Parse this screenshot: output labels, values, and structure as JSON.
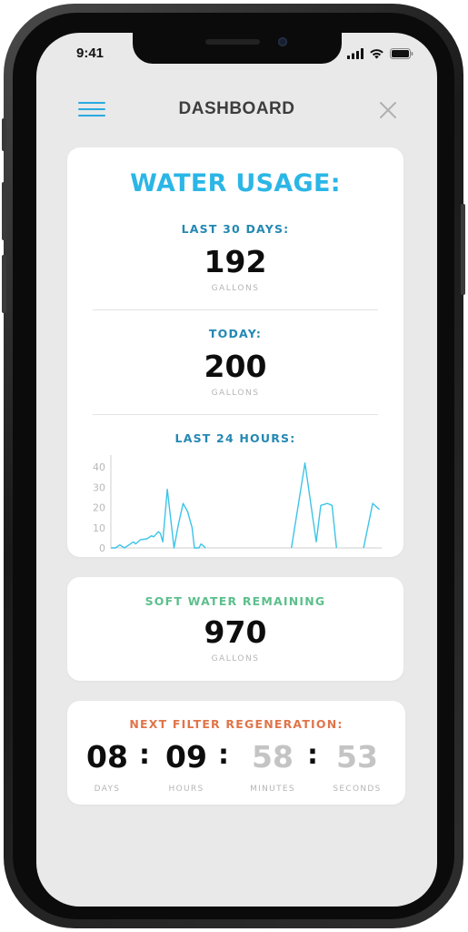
{
  "status_bar": {
    "time": "9:41",
    "icons": [
      "cellular-signal-icon",
      "wifi-icon",
      "battery-icon"
    ]
  },
  "header": {
    "title": "DASHBOARD",
    "menu_icon": "hamburger-menu-icon",
    "close_icon": "close-icon"
  },
  "colors": {
    "accent": "#2bb6e6",
    "label_blue": "#2488b3",
    "label_green": "#5cbf8c",
    "label_orange": "#e0744a",
    "chart_line": "#3cc4e8",
    "screen_bg": "#e9e9e9",
    "card_bg": "#ffffff"
  },
  "water_usage": {
    "title": "WATER USAGE:",
    "last_30_days": {
      "label": "LAST 30 DAYS:",
      "value": "192",
      "unit": "GALLONS"
    },
    "today": {
      "label": "TODAY:",
      "value": "200",
      "unit": "GALLONS"
    },
    "last_24_hours": {
      "label": "LAST 24 HOURS:"
    }
  },
  "soft_water": {
    "label": "SOFT WATER REMAINING",
    "value": "970",
    "unit": "GALLONS"
  },
  "regeneration": {
    "label": "NEXT FILTER REGENERATION:",
    "days": {
      "value": "08",
      "unit": "DAYS"
    },
    "hours": {
      "value": "09",
      "unit": "HOURS"
    },
    "minutes": {
      "value": "58",
      "unit": "MINUTES"
    },
    "seconds": {
      "value": "53",
      "unit": "SECONDS"
    },
    "separator": ":"
  },
  "chart_data": {
    "type": "line",
    "title": "",
    "xlabel": "",
    "ylabel": "",
    "ylim": [
      0,
      45
    ],
    "yticks": [
      "0",
      "10",
      "20",
      "30",
      "40"
    ],
    "grid": false,
    "series": [
      {
        "segments": [
          [
            [
              0,
              0
            ],
            [
              2,
              0
            ],
            [
              4,
              1.5
            ],
            [
              6,
              0
            ],
            [
              8,
              1.5
            ],
            [
              10,
              3
            ],
            [
              11,
              2
            ],
            [
              13,
              4
            ],
            [
              16,
              4.5
            ],
            [
              18,
              6
            ],
            [
              19,
              5.5
            ],
            [
              21,
              8
            ],
            [
              22,
              7
            ],
            [
              23,
              3
            ],
            [
              25,
              29
            ],
            [
              28,
              0
            ],
            [
              30,
              12
            ],
            [
              32,
              22
            ],
            [
              34,
              18
            ],
            [
              36,
              10
            ],
            [
              37,
              0
            ],
            [
              39,
              0
            ],
            [
              40,
              2
            ],
            [
              42,
              0
            ]
          ],
          [
            [
              80,
              0
            ],
            [
              86,
              42
            ],
            [
              91,
              3
            ],
            [
              93,
              21
            ],
            [
              96,
              22
            ],
            [
              98,
              21
            ],
            [
              100,
              0
            ]
          ],
          [
            [
              112,
              0
            ],
            [
              116,
              22
            ],
            [
              119,
              19
            ]
          ]
        ]
      }
    ]
  }
}
